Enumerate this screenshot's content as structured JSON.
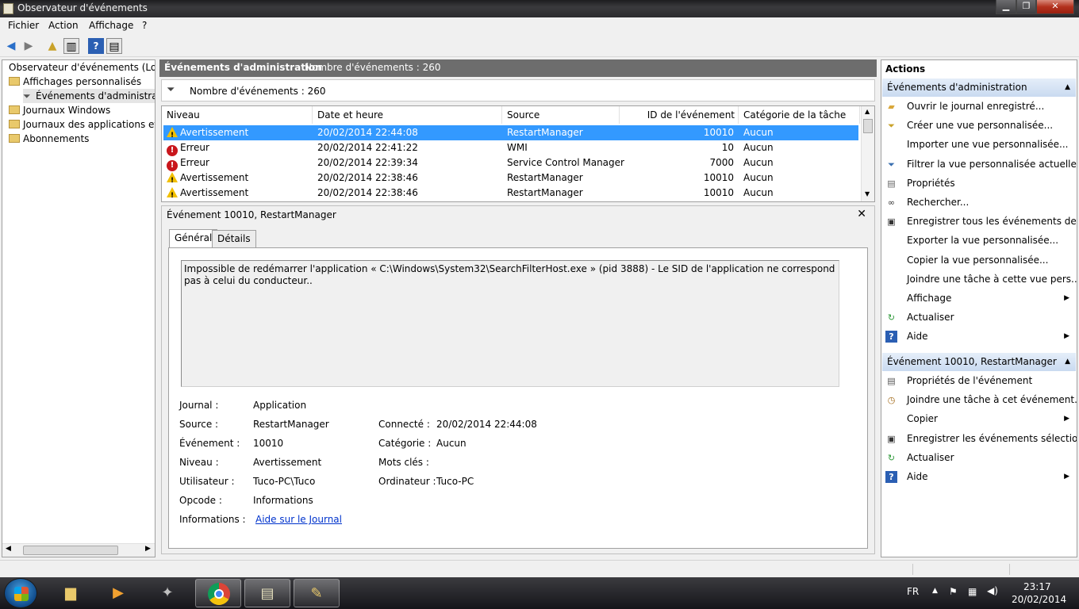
{
  "window": {
    "title": "Observateur d'événements"
  },
  "menu": [
    "Fichier",
    "Action",
    "Affichage",
    "?"
  ],
  "tree": {
    "root": "Observateur d'événements (Local)",
    "custom_views": "Affichages personnalisés",
    "admin_events": "Événements d'administratio",
    "windows_logs": "Journaux Windows",
    "app_logs": "Journaux des applications et de",
    "subscriptions": "Abonnements"
  },
  "middle": {
    "header_title": "Événements d'administration",
    "header_count": "Nombre d'événements : 260",
    "filter_count": "Nombre d'événements : 260"
  },
  "grid": {
    "columns": [
      "Niveau",
      "Date et heure",
      "Source",
      "ID de l'événement",
      "Catégorie de la tâche"
    ],
    "rows": [
      {
        "level": "Avertissement",
        "icon": "warning-icon",
        "datetime": "20/02/2014 22:44:08",
        "source": "RestartManager",
        "id": "10010",
        "category": "Aucun"
      },
      {
        "level": "Erreur",
        "icon": "error-icon",
        "datetime": "20/02/2014 22:41:22",
        "source": "WMI",
        "id": "10",
        "category": "Aucun"
      },
      {
        "level": "Erreur",
        "icon": "error-icon",
        "datetime": "20/02/2014 22:39:34",
        "source": "Service Control Manager",
        "id": "7000",
        "category": "Aucun"
      },
      {
        "level": "Avertissement",
        "icon": "warning-icon",
        "datetime": "20/02/2014 22:38:46",
        "source": "RestartManager",
        "id": "10010",
        "category": "Aucun"
      },
      {
        "level": "Avertissement",
        "icon": "warning-icon",
        "datetime": "20/02/2014 22:38:46",
        "source": "RestartManager",
        "id": "10010",
        "category": "Aucun"
      }
    ]
  },
  "detail": {
    "title": "Événement 10010, RestartManager",
    "tabs": [
      "Général",
      "Détails"
    ],
    "description": "Impossible de redémarrer l'application « C:\\Windows\\System32\\SearchFilterHost.exe » (pid 3888) - Le SID de l'application ne correspond pas à celui du conducteur..",
    "props": {
      "journal_label": "Journal :",
      "journal": "Application",
      "source_label": "Source :",
      "source": "RestartManager",
      "connected_label": "Connecté :",
      "connected": "20/02/2014 22:44:08",
      "event_label": "Événement :",
      "event": "10010",
      "category_label": "Catégorie :",
      "category": "Aucun",
      "level_label": "Niveau :",
      "level": "Avertissement",
      "keywords_label": "Mots clés :",
      "keywords": "",
      "user_label": "Utilisateur :",
      "user": "Tuco-PC\\Tuco",
      "computer_label": "Ordinateur :",
      "computer": "Tuco-PC",
      "opcode_label": "Opcode :",
      "opcode": "Informations",
      "info_label": "Informations :",
      "info_link": "Aide sur le Journal"
    }
  },
  "actions": {
    "title": "Actions",
    "section1": "Événements d'administration",
    "items1": [
      {
        "label": "Ouvrir le journal enregistré...",
        "icon": "open-folder-icon",
        "submenu": false
      },
      {
        "label": "Créer une vue personnalisée...",
        "icon": "filter-create-icon",
        "submenu": false
      },
      {
        "label": "Importer une vue personnalisée...",
        "icon": "",
        "submenu": false
      },
      {
        "label": "Filtrer la vue personnalisée actuelle...",
        "icon": "filter-icon",
        "submenu": false
      },
      {
        "label": "Propriétés",
        "icon": "properties-icon",
        "submenu": false
      },
      {
        "label": "Rechercher...",
        "icon": "binoculars-icon",
        "submenu": false
      },
      {
        "label": "Enregistrer tous les événements de...",
        "icon": "save-icon",
        "submenu": false
      },
      {
        "label": "Exporter la vue personnalisée...",
        "icon": "",
        "submenu": false
      },
      {
        "label": "Copier la vue personnalisée...",
        "icon": "",
        "submenu": false
      },
      {
        "label": "Joindre une tâche à cette vue pers...",
        "icon": "",
        "submenu": false
      },
      {
        "label": "Affichage",
        "icon": "",
        "submenu": true
      },
      {
        "label": "Actualiser",
        "icon": "refresh-icon",
        "submenu": false
      },
      {
        "label": "Aide",
        "icon": "help-icon",
        "submenu": true
      }
    ],
    "section2": "Événement 10010, RestartManager",
    "items2": [
      {
        "label": "Propriétés de l'événement",
        "icon": "event-properties-icon",
        "submenu": false
      },
      {
        "label": "Joindre une tâche à cet événement...",
        "icon": "task-icon",
        "submenu": false
      },
      {
        "label": "Copier",
        "icon": "",
        "submenu": true
      },
      {
        "label": "Enregistrer les événements sélectio...",
        "icon": "save-icon",
        "submenu": false
      },
      {
        "label": "Actualiser",
        "icon": "refresh-icon",
        "submenu": false
      },
      {
        "label": "Aide",
        "icon": "help-icon",
        "submenu": true
      }
    ]
  },
  "taskbar": {
    "language": "FR",
    "time": "23:17",
    "date": "20/02/2014"
  }
}
